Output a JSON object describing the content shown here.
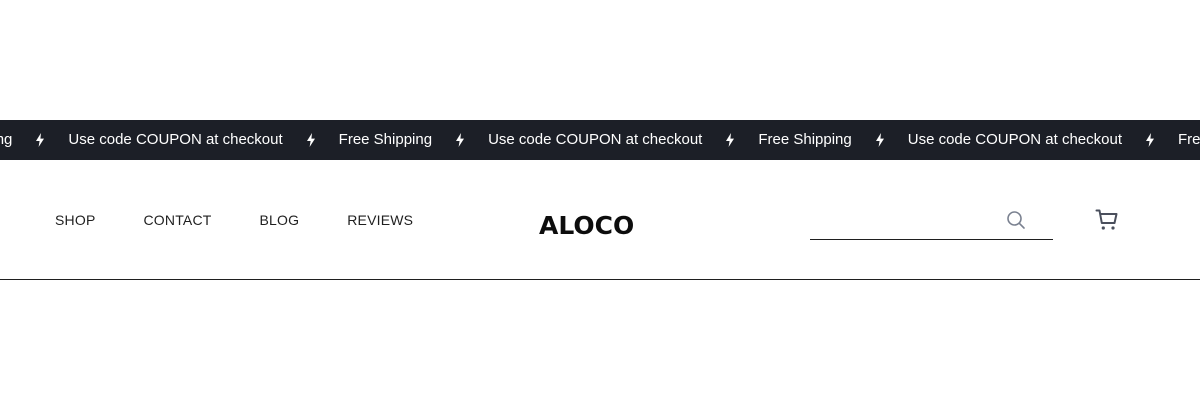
{
  "announcement": {
    "items": [
      "Free Shipping",
      "Use code COUPON at checkout",
      "Free Shipping",
      "Use code COUPON at checkout",
      "Free Shipping",
      "Use code COUPON at checkout",
      "Free Shipping"
    ],
    "separator_icon": "lightning-bolt-icon",
    "background": "#1c1f27",
    "text_color": "#ffffff"
  },
  "header": {
    "nav": [
      {
        "label": "SHOP"
      },
      {
        "label": "CONTACT"
      },
      {
        "label": "BLOG"
      },
      {
        "label": "REVIEWS"
      }
    ],
    "logo_text": "ALOCO",
    "search": {
      "value": "",
      "placeholder": "",
      "icon": "search-icon"
    },
    "cart_icon": "cart-icon"
  }
}
